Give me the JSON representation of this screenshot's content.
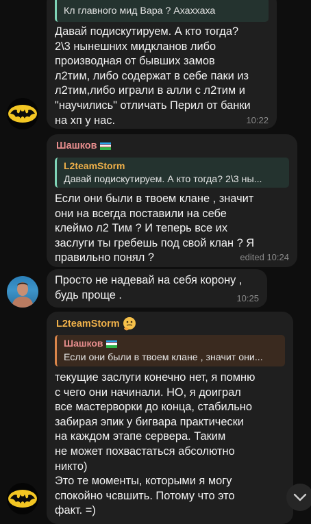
{
  "colors": {
    "background": "#0e0e0e",
    "bubble": "#1f1f1f",
    "accent_teal": "#7fd3b6",
    "accent_orange": "#d9854a",
    "sender_pink": "#e88e8e",
    "sender_gold": "#f0b14a",
    "timestamp": "#8a8a8a"
  },
  "messages": [
    {
      "reply": {
        "text": "Кл главного мид Вара ? Ахаххаха"
      },
      "text": "Давай подискутируем. А кто тогда?\n2\\3 нынешних мидкланов либо\nпроизводная от бывших замов\nл2тим, либо содержат в себе паки из\nл2тим,либо играли в алли с л2тим и\n\"научились\" отличать Перил от банки\nна хп у нас.",
      "time": "10:22",
      "avatar_icon": "batman-logo-icon"
    },
    {
      "sender": "Шашков",
      "sender_flag_icon": "uzbekistan-flag-icon",
      "reply": {
        "author": "L2teamStorm",
        "text": "Давай подискутируем. А кто тогда? 2\\3 ны..."
      },
      "text": "Если они были в твоем клане , значит\nони на всегда поставили на себе\nклеймо л2 Тим ? И теперь все их\nзаслуги ты гребешь под свой клан ? Я\nправильно понял ?",
      "time": "edited 10:24"
    },
    {
      "text": "Просто не надевай на себя корону ,\nбудь проще .",
      "time": "10:25",
      "avatar_icon": "user-photo-avatar"
    },
    {
      "sender": "L2teamStorm",
      "sender_badge_icon": "thinking-emoji-icon",
      "reply": {
        "author": "Шашков",
        "text": "Если они были в твоем клане , значит они..."
      },
      "text": "текущие заслуги конечно нет, я помню\nс чего они начинали. НО, я доиграл\nвсе мастерворки до конца, стабильно\nзабирая эпик у бигвара практически\nна каждом этапе сервера. Таким\nне может похвастаться абсолютно\nникто)\nЭто те моменты, которыми я могу\nспокойно чсвшить. Потому что это\nфакт. =)",
      "avatar_icon": "batman-logo-icon"
    }
  ],
  "scroll_button": {
    "icon": "chevron-down-icon"
  }
}
